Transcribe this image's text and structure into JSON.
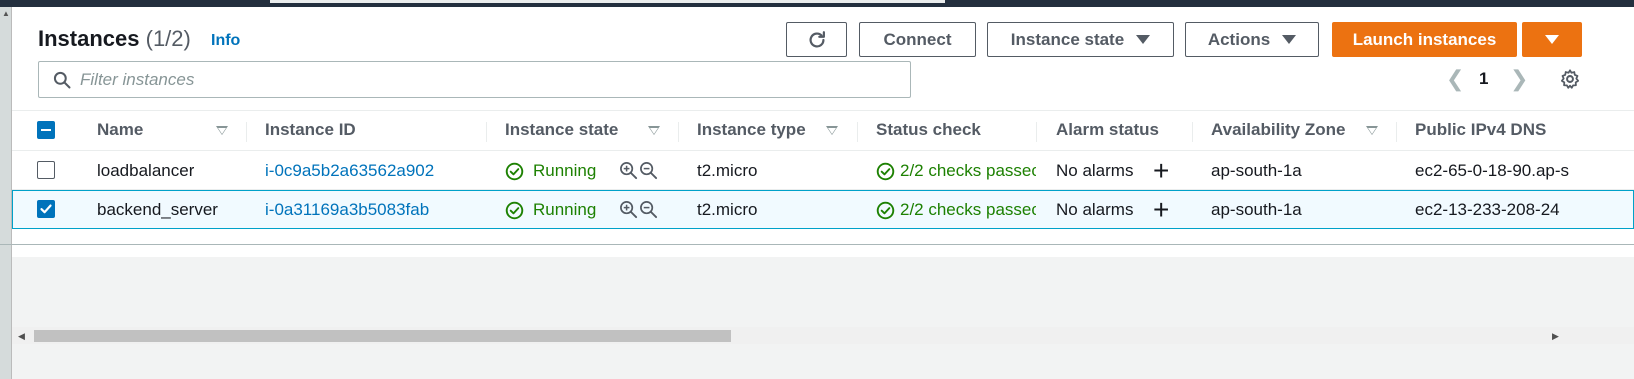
{
  "header": {
    "title": "Instances",
    "count": "(1/2)",
    "info_label": "Info"
  },
  "toolbar": {
    "refresh_icon": "refresh-icon",
    "connect_label": "Connect",
    "instance_state_label": "Instance state",
    "actions_label": "Actions",
    "launch_label": "Launch instances"
  },
  "search": {
    "placeholder": "Filter instances",
    "value": ""
  },
  "pagination": {
    "current_page": "1",
    "prev_icon": "chevron-left-icon",
    "next_icon": "chevron-right-icon"
  },
  "table": {
    "columns": [
      "Name",
      "Instance ID",
      "Instance state",
      "Instance type",
      "Status check",
      "Alarm status",
      "Availability Zone",
      "Public IPv4 DNS"
    ],
    "rows": [
      {
        "selected": false,
        "name": "loadbalancer",
        "instance_id": "i-0c9a5b2a63562a902",
        "state": "Running",
        "type": "t2.micro",
        "status_check": "2/2 checks passec",
        "alarm_status": "No alarms",
        "az": "ap-south-1a",
        "dns": "ec2-65-0-18-90.ap-s"
      },
      {
        "selected": true,
        "name": "backend_server",
        "instance_id": "i-0a31169a3b5083fab",
        "state": "Running",
        "type": "t2.micro",
        "status_check": "2/2 checks passec",
        "alarm_status": "No alarms",
        "az": "ap-south-1a",
        "dns": "ec2-13-233-208-24"
      }
    ]
  },
  "colors": {
    "primary": "#ec7211",
    "link": "#0073bb",
    "success": "#1d8102",
    "selected_row_bg": "#f1faff",
    "selected_row_border": "#00a1c9"
  }
}
